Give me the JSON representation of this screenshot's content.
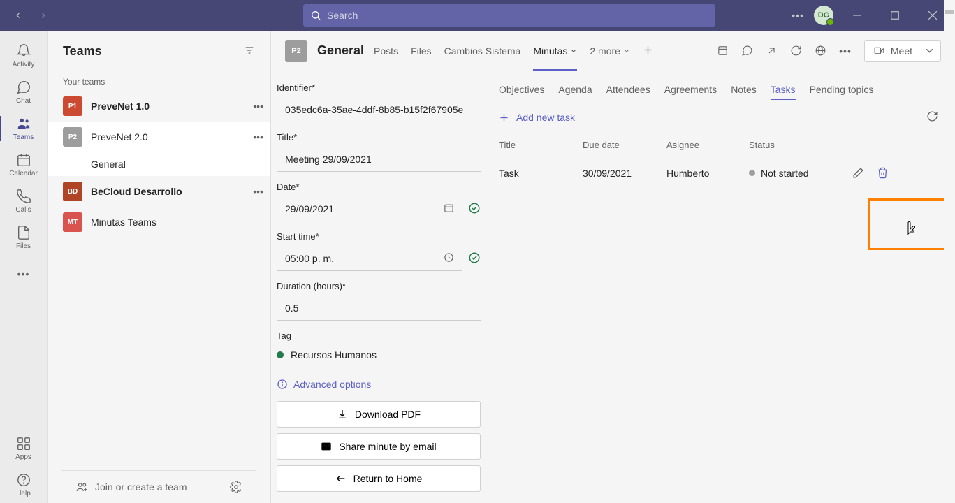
{
  "search_placeholder": "Search",
  "avatar": "DG",
  "rail": [
    {
      "label": "Activity"
    },
    {
      "label": "Chat"
    },
    {
      "label": "Teams"
    },
    {
      "label": "Calendar"
    },
    {
      "label": "Calls"
    },
    {
      "label": "Files"
    }
  ],
  "rail_bottom": [
    {
      "label": "Apps"
    },
    {
      "label": "Help"
    }
  ],
  "sidebar": {
    "title": "Teams",
    "section": "Your teams",
    "teams": [
      {
        "badge": "P1",
        "name": "PreveNet 1.0"
      },
      {
        "badge": "P2",
        "name": "PreveNet 2.0"
      },
      {
        "badge": "BD",
        "name": "BeCloud Desarrollo"
      },
      {
        "badge": "MT",
        "name": "Minutas Teams"
      }
    ],
    "channel": "General",
    "footer": "Join or create a team"
  },
  "channel_header": {
    "badge": "P2",
    "name": "General",
    "tabs": [
      "Posts",
      "Files",
      "Cambios Sistema",
      "Minutas",
      "2 more"
    ],
    "meet": "Meet"
  },
  "form": {
    "identifier_label": "Identifier*",
    "identifier": "035edc6a-35ae-4ddf-8b85-b15f2f67905e",
    "title_label": "Title*",
    "title": "Meeting  29/09/2021",
    "date_label": "Date*",
    "date": "29/09/2021",
    "start_label": "Start time*",
    "start": "05:00  p. m.",
    "duration_label": "Duration (hours)*",
    "duration": "0.5",
    "tag_label": "Tag",
    "tag": "Recursos Humanos",
    "advanced": "Advanced options",
    "download": "Download PDF",
    "share": "Share minute by email",
    "return": "Return to Home"
  },
  "tasks": {
    "tabs": [
      "Objectives",
      "Agenda",
      "Attendees",
      "Agreements",
      "Notes",
      "Tasks",
      "Pending topics"
    ],
    "add": "Add new task",
    "headers": {
      "title": "Title",
      "due": "Due date",
      "asg": "Asignee",
      "status": "Status"
    },
    "row": {
      "title": "Task",
      "due": "30/09/2021",
      "asg": "Humberto",
      "status": "Not started"
    }
  }
}
